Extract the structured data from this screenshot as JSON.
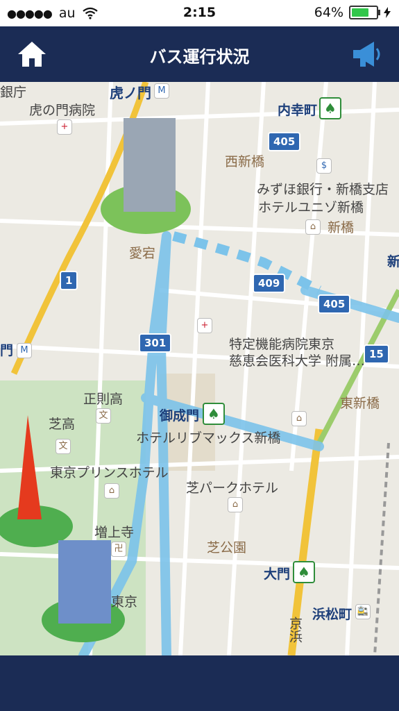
{
  "status_bar": {
    "carrier": "au",
    "time": "2:15",
    "battery_percent": "64%"
  },
  "header": {
    "title": "バス運行状況",
    "home_icon": "home-icon",
    "announcement_icon": "megaphone-icon"
  },
  "map": {
    "labels": {
      "toranomon": "虎ノ門",
      "toranomon_hospital": "虎の門病院",
      "uchisaiwaicho": "内幸町",
      "nishishinbashi": "西新橋",
      "mizuho": "みずほ銀行・新橋支店",
      "hotel_unizo": "ホテルユニゾ新橋",
      "shinbashi": "新橋",
      "atago": "愛宕",
      "jikei": "特定機能病院東京\n慈恵会医科大学 附属…",
      "seisoku": "正則高",
      "shiba_high": "芝高",
      "onarimon": "御成門",
      "hotel_livemax": "ホテルリブマックス新橋",
      "higashi_shinbashi": "東新橋",
      "tokyo_prince": "東京プリンスホテル",
      "shiba_park_hotel": "芝パークホテル",
      "zojoji": "増上寺",
      "shiba_koen": "芝公園",
      "daimon": "大門",
      "hamamatsucho": "浜松町",
      "tokyo_fragment": "東京",
      "keihin": "京浜",
      "partial_ginko": "銀庁",
      "partial_shin": "新",
      "partial_mon": "門"
    },
    "routes": {
      "r1": "1",
      "r301": "301",
      "r405a": "405",
      "r405b": "405",
      "r409": "409",
      "r15": "15"
    }
  },
  "colors": {
    "header_bg": "#1b2c55",
    "route": "#7cc3ea",
    "map_bg": "#eceae3",
    "accent_green": "#2f8d3a"
  }
}
